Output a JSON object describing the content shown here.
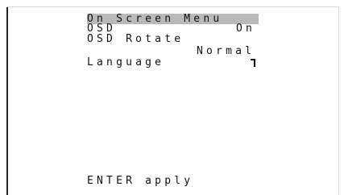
{
  "osd": {
    "title": "On Screen Menu",
    "items": [
      {
        "label": "OSD",
        "value": "On"
      },
      {
        "label": "OSD Rotate",
        "value": "Normal"
      },
      {
        "label": "Language",
        "value": ""
      }
    ],
    "hint": "ENTER apply"
  },
  "colors": {
    "highlight": "#b9b9b9",
    "text": "#111111",
    "frame": "#222222"
  },
  "icons": {
    "language_indicator": "corner-bracket-icon"
  }
}
